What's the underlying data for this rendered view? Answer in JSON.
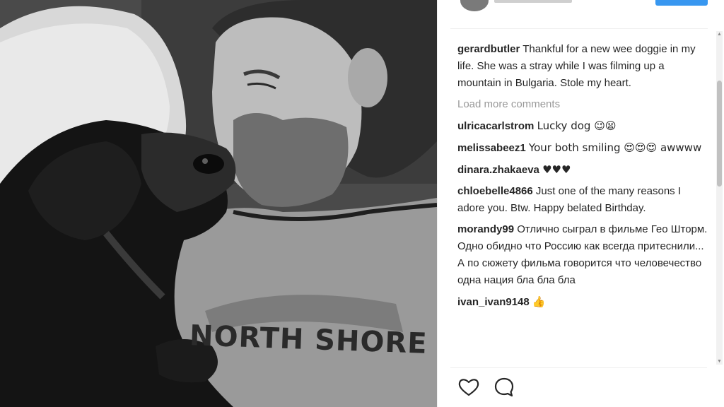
{
  "photo": {
    "shirt_text": "NORTH SHORE"
  },
  "post": {
    "caption": {
      "username": "gerardbutler",
      "text": "Thankful for a new wee doggie in my life. She was a stray while I was filming up a mountain in Bulgaria. Stole my heart."
    },
    "load_more_label": "Load more comments",
    "comments": [
      {
        "username": "ulricacarlstrom",
        "text": "Lucky dog 😉😫"
      },
      {
        "username": "melissabeez1",
        "text": "Your both smiling 😍😍😍 awwww"
      },
      {
        "username": "dinara.zhakaeva",
        "text": "♥♥♥"
      },
      {
        "username": "chloebelle4866",
        "text": "Just one of the many reasons I adore you. Btw. Happy belated Birthday."
      },
      {
        "username": "morandy99",
        "text": "Отлично сыграл в фильме Гео Шторм. Одно обидно что Россию как всегда притеснили... А по сюжету фильма говорится что человечество одна нация бла бла бла"
      },
      {
        "username": "ivan_ivan9148",
        "text": "👍"
      }
    ]
  },
  "actions": {
    "like_icon": "heart-icon",
    "comment_icon": "comment-icon"
  },
  "colors": {
    "username": "#262626",
    "text": "#262626",
    "muted": "#999999",
    "accent": "#3897f0"
  }
}
